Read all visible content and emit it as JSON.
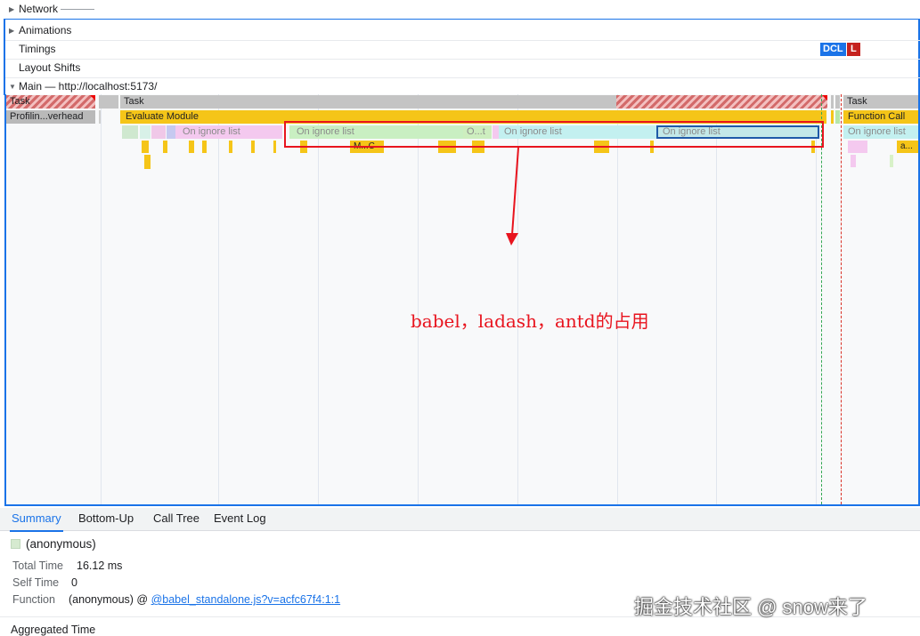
{
  "tracks": {
    "network": "Network",
    "animations": "Animations",
    "timings": "Timings",
    "layout_shifts": "Layout Shifts",
    "main": "Main — http://localhost:5173/"
  },
  "markers": {
    "dcl": "DCL",
    "l": "L"
  },
  "flame": {
    "task_left": "Task",
    "task_mid": "Task",
    "task_right": "Task",
    "profiling": "Profilin...verhead",
    "evaluate": "Evaluate Module",
    "function_call": "Function Call",
    "ignore1": "On ignore list",
    "ignore2": "On ignore list",
    "ignore3": "O...t",
    "ignore4": "On ignore list",
    "ignore5": "On ignore list",
    "ignore6": "On ignore list",
    "mc": "M...C",
    "a": "a..."
  },
  "annotation": {
    "text": "babel，ladash，antd的占用",
    "color": "#e8141e"
  },
  "tabs": [
    "Summary",
    "Bottom-Up",
    "Call Tree",
    "Event Log"
  ],
  "summary": {
    "name": "(anonymous)",
    "total_time_label": "Total Time",
    "total_time": "16.12 ms",
    "self_time_label": "Self Time",
    "self_time": "0",
    "function_label": "Function",
    "function_prefix": "(anonymous) @ ",
    "function_link": "@babel_standalone.js?v=acfc67f4:1:1",
    "aggregated": "Aggregated Time"
  },
  "watermark": "掘金技术社区 @ snow来了",
  "colors": {
    "accent": "#1a73e8",
    "task_yellow": "#f5c518",
    "annotation_red": "#e8141e"
  }
}
